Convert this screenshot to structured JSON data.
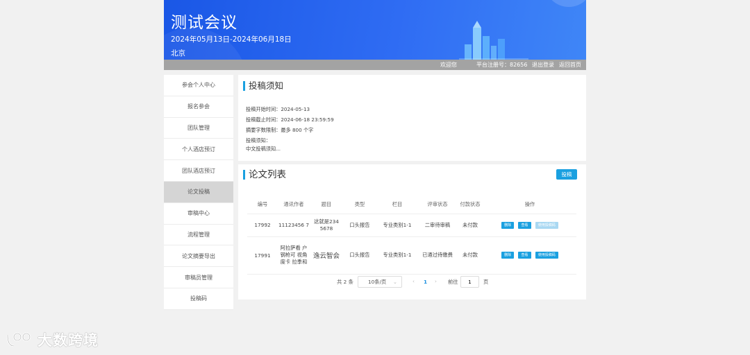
{
  "header": {
    "title": "测试会议",
    "dates": "2024年05月13日-2024年06月18日",
    "city": "北京"
  },
  "topbar": {
    "welcome": "欢迎您",
    "registration": "平台注册号：82656",
    "logout": "退出登录",
    "home": "返回首页"
  },
  "sidebar": {
    "items": [
      {
        "label": "参会个人中心"
      },
      {
        "label": "报名参会"
      },
      {
        "label": "团队管理"
      },
      {
        "label": "个人酒店预订"
      },
      {
        "label": "团队酒店预订"
      },
      {
        "label": "论文投稿"
      },
      {
        "label": "审稿中心"
      },
      {
        "label": "流程管理"
      },
      {
        "label": "论文摘要导出"
      },
      {
        "label": "审稿员管理"
      },
      {
        "label": "投稿码"
      }
    ],
    "active_index": 5
  },
  "notice": {
    "title": "投稿须知",
    "start": "投稿开始时间：2024-05-13",
    "end": "投稿截止时间：2024-06-18 23:59:59",
    "limit": "摘要字数限制：最多 800 个字",
    "notice_label": "投稿须知：",
    "notice_text": "中文投稿须知..."
  },
  "papers": {
    "title": "论文列表",
    "submit_label": "投稿",
    "columns": [
      "编号",
      "通讯作者",
      "题目",
      "类型",
      "栏目",
      "评审状态",
      "付款状态",
      "操作"
    ],
    "rows": [
      {
        "id": "17992",
        "author": "11123456 7",
        "title": "这就是234 5678",
        "type": "口头报告",
        "column": "专业类别1-1",
        "audit": "二审待审稿",
        "pay": "未付款",
        "ops": [
          "删除",
          "查看",
          "使用投稿码"
        ]
      },
      {
        "id": "17991",
        "author": "阿拉萨看 户钢枪可 视角度卡 拉季和",
        "title": "逸云智会",
        "type": "口头报告",
        "column": "专业类别1-1",
        "audit": "已通过待缴费",
        "pay": "未付款",
        "ops": [
          "删除",
          "查看",
          "使用投稿码"
        ]
      }
    ]
  },
  "pager": {
    "total": "共 2 条",
    "page_size": "10条/页",
    "current": "1",
    "goto_label": "前往",
    "goto_value": "1",
    "page_unit": "页"
  },
  "watermark": {
    "text": "大数跨境"
  },
  "colors": {
    "accent": "#1aa0e0",
    "banner": "#2f6cf3",
    "danger": "#e63b3b"
  }
}
